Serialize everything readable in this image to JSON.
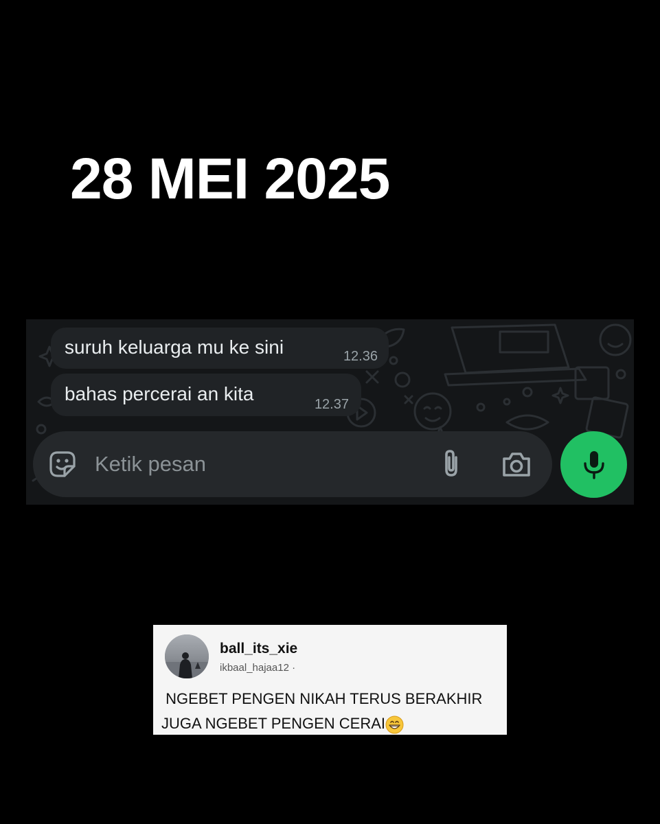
{
  "header": {
    "date": "28 MEI 2025"
  },
  "chat": {
    "messages": [
      {
        "text": "suruh keluarga mu ke sini",
        "time": "12.36"
      },
      {
        "text": "bahas percerai an kita",
        "time": "12.37"
      }
    ],
    "composer": {
      "placeholder": "Ketik pesan",
      "icons": [
        "sticker-icon",
        "paperclip-icon",
        "camera-icon",
        "microphone-icon"
      ]
    },
    "colors": {
      "background": "#141618",
      "bubble": "#202326",
      "composer": "#25282b",
      "mic_button": "#21c063"
    }
  },
  "comment": {
    "username": "ball_its_xie",
    "handle": "ikbaal_hajaa12 ·",
    "text_line1": " NGEBET PENGEN NIKAH TERUS BERAKHIR",
    "text_line2": "JUGA NGEBET PENGEN CERAI",
    "emoji": "grinning-face-emoji"
  }
}
